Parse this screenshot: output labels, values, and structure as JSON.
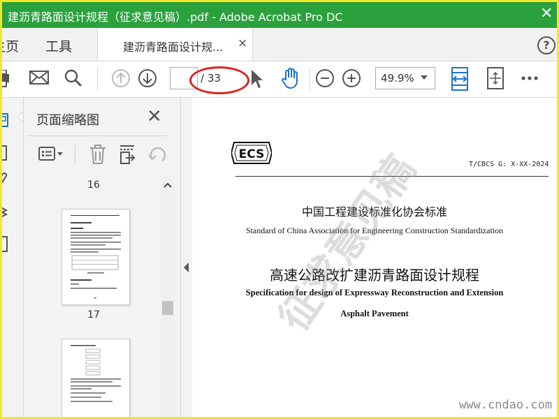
{
  "window": {
    "title": "建沥青路面设计规程（征求意见稿）.pdf - Adobe Acrobat Pro DC",
    "close_glyph": "✕"
  },
  "tabs": {
    "home": "主页",
    "tools": "工具",
    "document": "建沥青路面设计规...",
    "document_close": "×",
    "help": "?"
  },
  "toolbar": {
    "page_current": "",
    "page_total": "/ 33",
    "zoom": "49.9%"
  },
  "thumbnail_panel": {
    "title": "页面缩略图",
    "close": "✕",
    "pages": [
      {
        "number": "16"
      },
      {
        "number": "17"
      }
    ]
  },
  "document": {
    "code": "T/CBCS G: X-XX-2024",
    "logo_text": "ECS",
    "org_cn": "中国工程建设标准化协会标准",
    "org_en": "Standard of China Association for Engineering Construction Standardization",
    "title_cn": "高速公路改扩建沥青路面设计规程",
    "title_en_line1": "Specification for design of Expressway Reconstruction and Extension",
    "title_en_line2": "Asphalt Pavement",
    "watermark": "征求意见稿",
    "site_watermark": "www.cndao.com"
  },
  "colors": {
    "titlebar": "#2aa13c",
    "accent_icon": "#1a73c9",
    "annotation_ring": "#e02020",
    "frame": "#f4e629"
  }
}
